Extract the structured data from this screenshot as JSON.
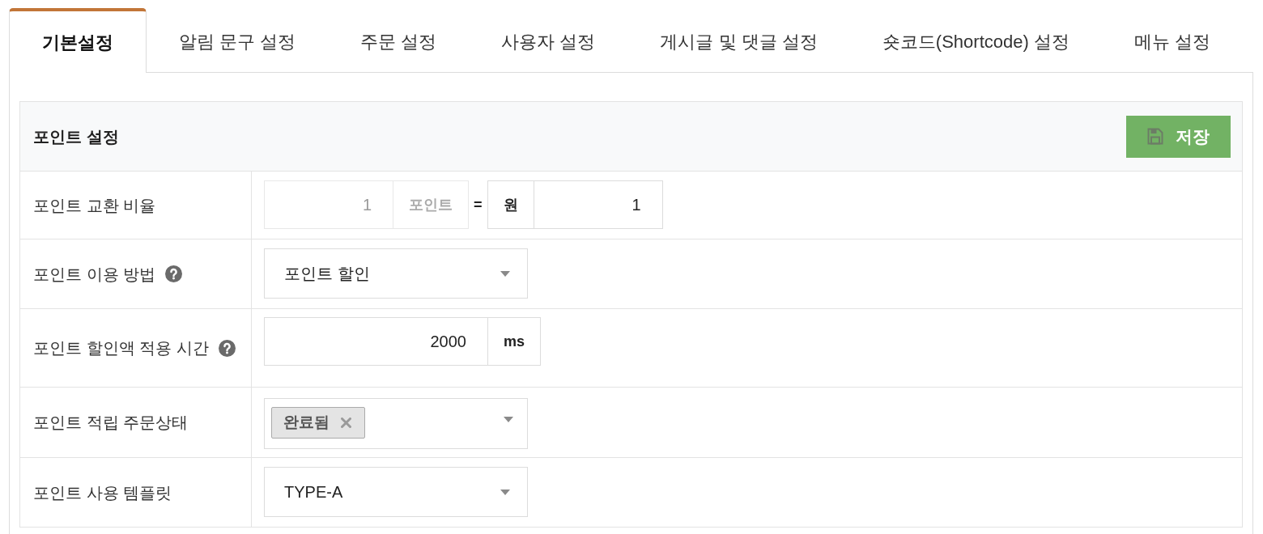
{
  "tabs": [
    {
      "label": "기본설정",
      "selected": true
    },
    {
      "label": "알림 문구 설정",
      "selected": false
    },
    {
      "label": "주문 설정",
      "selected": false
    },
    {
      "label": "사용자 설정",
      "selected": false
    },
    {
      "label": "게시글 및 댓글 설정",
      "selected": false
    },
    {
      "label": "숏코드(Shortcode) 설정",
      "selected": false
    },
    {
      "label": "메뉴 설정",
      "selected": false
    }
  ],
  "section": {
    "title": "포인트 설정",
    "save_button": "저장"
  },
  "rows": [
    {
      "kind": "ratio",
      "label": "포인트 교환 비율",
      "help": false,
      "parts": [
        {
          "kind": "input",
          "value": "1",
          "disabled": true
        },
        {
          "kind": "addon",
          "text": "포인트",
          "disabled": true
        },
        {
          "kind": "text",
          "text": "="
        },
        {
          "kind": "addon",
          "text": "원",
          "disabled": false
        },
        {
          "kind": "input",
          "value": "1",
          "disabled": false
        }
      ]
    },
    {
      "kind": "select",
      "label": "포인트 이용 방법",
      "help": true,
      "value": "포인트 할인"
    },
    {
      "kind": "input_unit",
      "label": "포인트 할인액 적용 시간",
      "help": true,
      "value": "2000",
      "unit": "ms"
    },
    {
      "kind": "multiselect",
      "label": "포인트 적립 주문상태",
      "help": false,
      "tags": [
        {
          "label": "완료됨"
        }
      ]
    },
    {
      "kind": "select",
      "label": "포인트 사용 템플릿",
      "help": false,
      "value": "TYPE-A"
    }
  ]
}
